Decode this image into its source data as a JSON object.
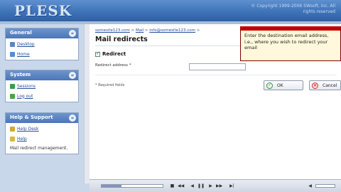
{
  "header": {
    "logo": "PLESK",
    "copyright": "© Copyright 1999-2006 SWsoft, Inc. All rights reserved"
  },
  "sidebar": {
    "general": {
      "title": "General",
      "items": [
        {
          "label": "Desktop",
          "icon": "desktop-icon"
        },
        {
          "label": "Home",
          "icon": "home-icon"
        }
      ]
    },
    "system": {
      "title": "System",
      "items": [
        {
          "label": "Sessions",
          "icon": "sessions-icon"
        },
        {
          "label": "Log out",
          "icon": "logout-icon"
        }
      ]
    },
    "help": {
      "title": "Help & Support",
      "items": [
        {
          "label": "Help Desk",
          "icon": "helpdesk-icon"
        },
        {
          "label": "Help",
          "icon": "help-icon"
        }
      ],
      "status": "Mail redirect management."
    }
  },
  "main": {
    "breadcrumb": {
      "domain": "somesite123.com",
      "sep1": " > ",
      "mail": "Mail",
      "sep2": " > ",
      "address": "info@somesite123.com",
      "sep3": " >"
    },
    "title": "Mail redirects",
    "section": "Redirect",
    "redirect_label": "Redirect address *",
    "redirect_value": "",
    "required_note": "* Required fields",
    "ok_label": "OK",
    "cancel_label": "Cancel"
  },
  "tooltip": {
    "text": "Enter the destination email address, i.e., where you wish to redirect your email"
  },
  "player": {
    "progress": 0.32
  },
  "colors": {
    "header": "#3f73b9",
    "sidebar_bg": "#c9d7ea",
    "tooltip_border": "#c40000",
    "ok": "#2f9a3a",
    "cancel": "#cf2a2a"
  }
}
